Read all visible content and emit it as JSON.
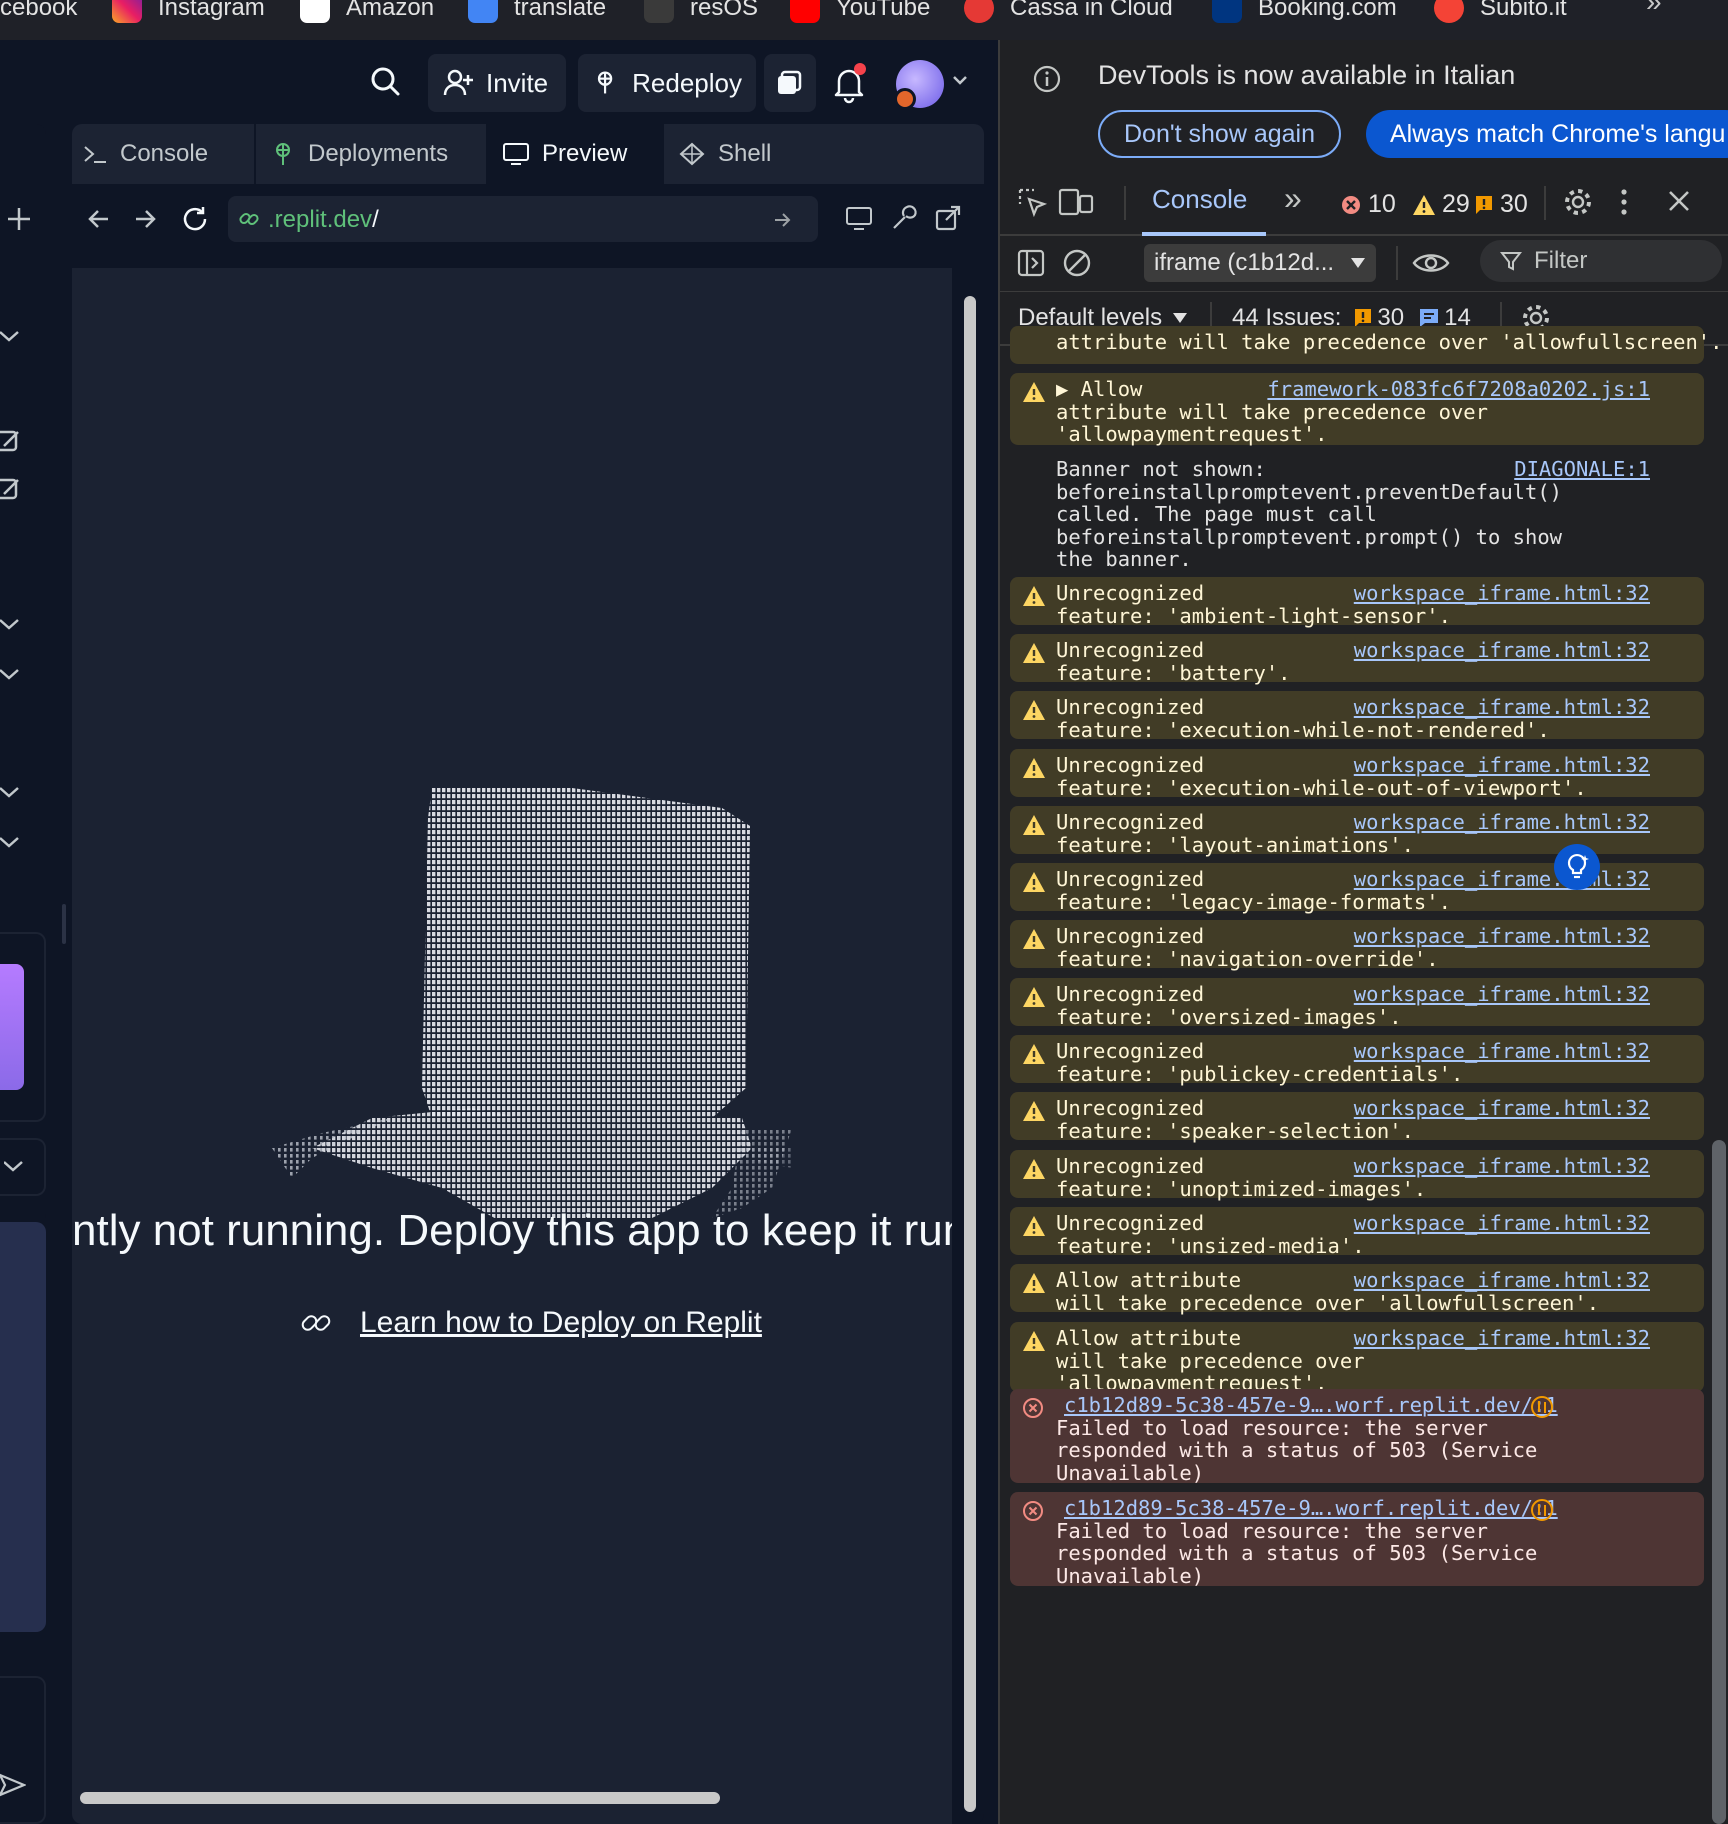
{
  "bookmarks": {
    "items": [
      "cebook",
      "Instagram",
      "Amazon",
      "translate",
      "resOS",
      "YouTube",
      "Cassa in Cloud",
      "Booking.com",
      "Subito.it"
    ],
    "more": "»"
  },
  "replit": {
    "topbar": {
      "invite_label": "Invite",
      "redeploy_label": "Redeploy"
    },
    "tabs": [
      "Console",
      "Deployments",
      "Preview",
      "Shell"
    ],
    "active_tab": "Preview",
    "url": {
      "host": ".replit.dev",
      "path": "/"
    },
    "preview": {
      "message": "ntly not running. Deploy this app to keep it run",
      "learn_link": "Learn how to Deploy on Replit"
    }
  },
  "devtools": {
    "info_text": "DevTools is now available in Italian",
    "dont_show_label": "Don't show again",
    "always_match_label": "Always match Chrome's langu",
    "console_tab": "Console",
    "more_tabs": "»",
    "counts": {
      "errors": "10",
      "warnings": "29",
      "issues": "30"
    },
    "context": "iframe (c1b12d...",
    "filter_placeholder": "Filter",
    "levels_label": "Default levels",
    "issues_label": "44 Issues:",
    "issues_warn": "30",
    "issues_info": "14",
    "entries": [
      {
        "type": "warn",
        "source": "",
        "text": "attribute will take precedence over 'allowfullscreen'."
      },
      {
        "type": "warn",
        "source": "framework-083fc6f7208a0202.js:1",
        "text": "▶ Allow      \nattribute will take precedence over\n'allowpaymentrequest'."
      },
      {
        "type": "plain",
        "source": "DIAGONALE:1",
        "text": "Banner not shown:\nbeforeinstallpromptevent.preventDefault()\ncalled. The page must call\nbeforeinstallpromptevent.prompt() to show\nthe banner."
      },
      {
        "type": "warn",
        "source": "workspace_iframe.html:32",
        "text": "Unrecognized\nfeature: 'ambient-light-sensor'."
      },
      {
        "type": "warn",
        "source": "workspace_iframe.html:32",
        "text": "Unrecognized\nfeature: 'battery'."
      },
      {
        "type": "warn",
        "source": "workspace_iframe.html:32",
        "text": "Unrecognized\nfeature: 'execution-while-not-rendered'."
      },
      {
        "type": "warn",
        "source": "workspace_iframe.html:32",
        "text": "Unrecognized\nfeature: 'execution-while-out-of-viewport'."
      },
      {
        "type": "warn",
        "source": "workspace_iframe.html:32",
        "text": "Unrecognized\nfeature: 'layout-animations'."
      },
      {
        "type": "warn",
        "source": "workspace_iframe.html:32",
        "text": "Unrecognized\nfeature: 'legacy-image-formats'."
      },
      {
        "type": "warn",
        "source": "workspace_iframe.html:32",
        "text": "Unrecognized\nfeature: 'navigation-override'."
      },
      {
        "type": "warn",
        "source": "workspace_iframe.html:32",
        "text": "Unrecognized\nfeature: 'oversized-images'."
      },
      {
        "type": "warn",
        "source": "workspace_iframe.html:32",
        "text": "Unrecognized\nfeature: 'publickey-credentials'."
      },
      {
        "type": "warn",
        "source": "workspace_iframe.html:32",
        "text": "Unrecognized\nfeature: 'speaker-selection'."
      },
      {
        "type": "warn",
        "source": "workspace_iframe.html:32",
        "text": "Unrecognized\nfeature: 'unoptimized-images'."
      },
      {
        "type": "warn",
        "source": "workspace_iframe.html:32",
        "text": "Unrecognized\nfeature: 'unsized-media'."
      },
      {
        "type": "warn",
        "source": "workspace_iframe.html:32",
        "text": "Allow attribute\nwill take precedence over 'allowfullscreen'."
      },
      {
        "type": "warn",
        "source": "workspace_iframe.html:32",
        "text": "Allow attribute\nwill take precedence over\n'allowpaymentrequest'."
      },
      {
        "type": "err",
        "source": "c1b12d89-5c38-457e-9….worf.replit.dev/:1",
        "text": "\nFailed to load resource: the server\nresponded with a status of 503 (Service\nUnavailable)"
      },
      {
        "type": "err",
        "source": "c1b12d89-5c38-457e-9….worf.replit.dev/:1",
        "text": "\nFailed to load resource: the server\nresponded with a status of 503 (Service\nUnavailable)"
      }
    ]
  },
  "colors": {
    "replit_bg": "#0e1525",
    "devtools_bg": "#202124",
    "warn_bg": "#413c26",
    "error_bg": "#4e3534",
    "link": "#a8c7fa"
  }
}
